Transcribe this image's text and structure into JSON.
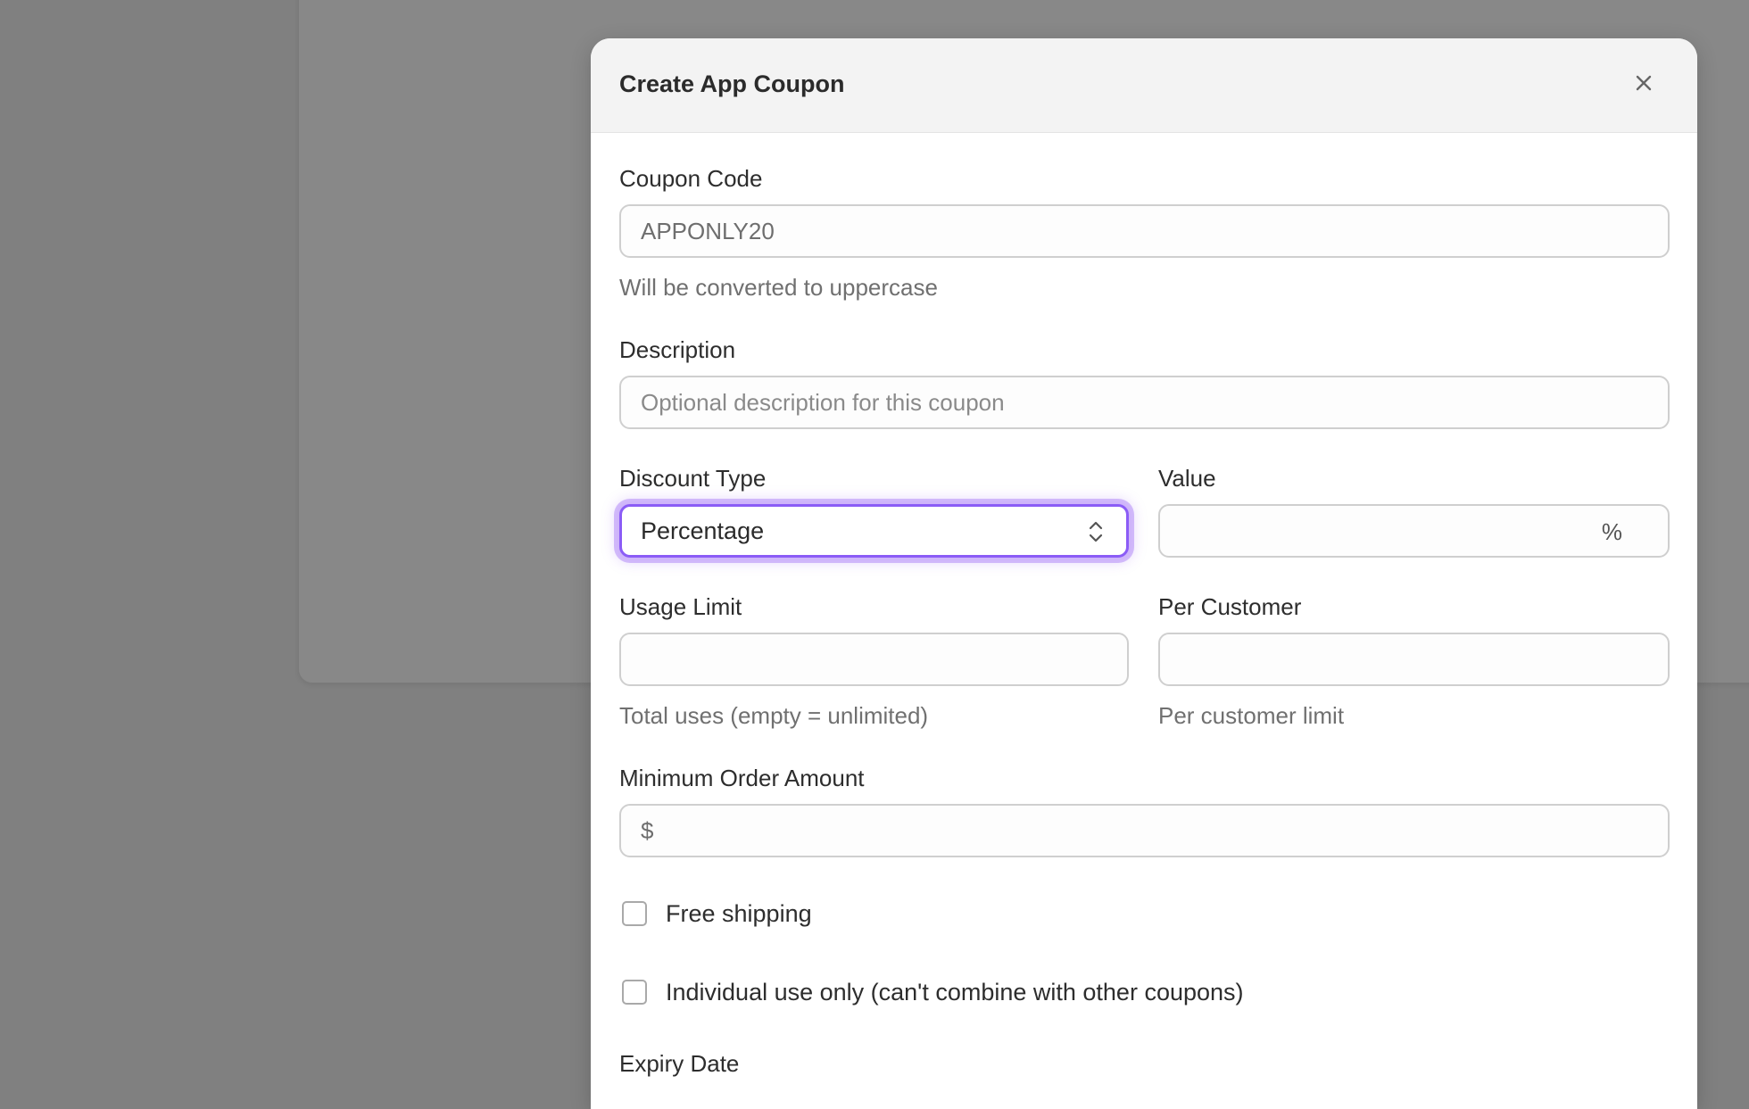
{
  "modal": {
    "title": "Create App Coupon",
    "close_icon": "close-icon"
  },
  "coupon_code": {
    "label": "Coupon Code",
    "value": "APPONLY20",
    "help": "Will be converted to uppercase"
  },
  "description": {
    "label": "Description",
    "placeholder": "Optional description for this coupon"
  },
  "discount_type": {
    "label": "Discount Type",
    "selected": "Percentage",
    "icon": "chevron-up-down-icon"
  },
  "value": {
    "label": "Value",
    "suffix": "%"
  },
  "usage_limit": {
    "label": "Usage Limit",
    "help": "Total uses (empty = unlimited)"
  },
  "per_customer": {
    "label": "Per Customer",
    "help": "Per customer limit"
  },
  "min_order": {
    "label": "Minimum Order Amount",
    "prefix": "$"
  },
  "free_shipping": {
    "label": "Free shipping",
    "checked": false
  },
  "individual_use": {
    "label": "Individual use only (can't combine with other coupons)",
    "checked": false
  },
  "expiry_date": {
    "label": "Expiry Date"
  },
  "colors": {
    "focus_ring": "#8b5cf6",
    "overlay": "#808080"
  }
}
